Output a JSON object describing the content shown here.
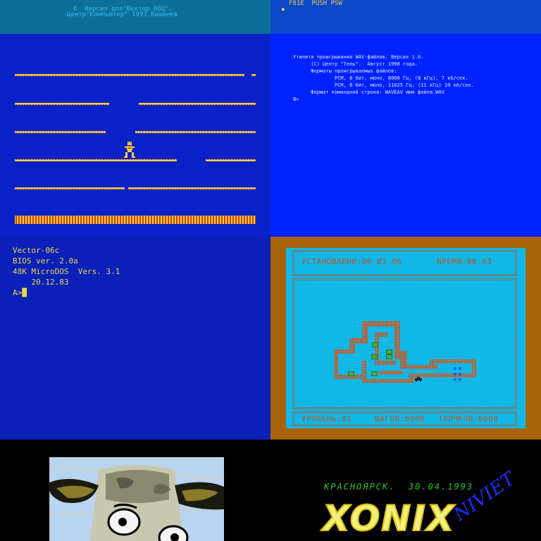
{
  "panel1": {
    "credit_line1": "©  Версия для\"Вектор 06Ц\".",
    "credit_line2": "Центр\"Компьютер\" 1991.Кишинев",
    "colors": {
      "header_bg": "#0c6f99",
      "field_bg": "#0a20c8",
      "platform": "#f0d040",
      "platform_dash": "#d04010",
      "text": "#38b8f0"
    },
    "character_icon": "skeleton-runner-icon"
  },
  "panel2": {
    "header_text": "F81E  PUSH PSW",
    "header_cursor": "■",
    "lines": [
      "Утилита проигрывания WAV-файлов. Версия 1.0.",
      "      (C) Центр \"Тень\".  Август 1998 года.",
      "",
      "      Форматы проигрываемых файлов:",
      "              PCM, 8 бит, моно, 8000 Гц, (8 кГц), 7 кб/сек.",
      "              PCM, 8 бит, моно, 11025 Гц, (11 кГц) 10 кб/сек.",
      "",
      "      Формат командной строки: WAVEAV имя файла.WAV",
      "",
      "B>"
    ]
  },
  "panel3": {
    "lines": [
      "Vector-06c",
      "BIOS ver. 2.0a",
      "48K MicroDOS  Vers. 3.1",
      "    20.12.83",
      "A>"
    ],
    "cursor": "█"
  },
  "panel4": {
    "status_installed": "УСТАНОВЛЕНО:00 ИЗ 06",
    "status_time": "ВРЕМЯ:00.03",
    "level": "УРОВЕНЬ:01",
    "steps": "ШАГОВ:0000",
    "pushes": "ТОЛЧКОВ:0000",
    "colors": {
      "frame_bg": "#10b8e8",
      "wall": "#c06030",
      "box": "#48a848",
      "target": "#1060e0",
      "text": "#c05020"
    }
  },
  "panel5": {
    "image_icon": "cow-face-icon"
  },
  "panel6": {
    "header": "КРАСНОЯРСК.  30.04.1993",
    "title": "XONIX",
    "signature": "NIVIET",
    "colors": {
      "header": "#28c828",
      "title_fill": "#f0f080",
      "title_outline": "#e0c000",
      "signature": "#1830ff"
    }
  }
}
